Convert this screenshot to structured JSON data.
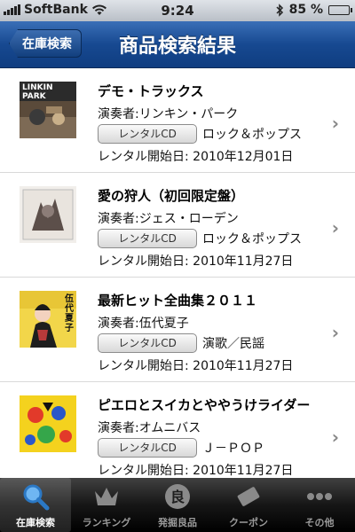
{
  "status": {
    "carrier": "SoftBank",
    "time": "9:24",
    "battery": "85 %",
    "battery_level": 0.85
  },
  "navbar": {
    "back_label": "在庫検索",
    "title": "商品検索結果"
  },
  "results": [
    {
      "title": "デモ・トラックス",
      "artist": "演奏者:リンキン・パーク",
      "format": "レンタルCD",
      "genre": "ロック＆ポップス",
      "rental_start": "レンタル開始日: 2010年12月01日",
      "cover_text": "LINKIN PARK"
    },
    {
      "title": "愛の狩人（初回限定盤）",
      "artist": "演奏者:ジェス・ローデン",
      "format": "レンタルCD",
      "genre": "ロック＆ポップス",
      "rental_start": "レンタル開始日: 2010年11月27日",
      "cover_text": ""
    },
    {
      "title": "最新ヒット全曲集２０１１",
      "artist": "演奏者:伍代夏子",
      "format": "レンタルCD",
      "genre": "演歌／民謡",
      "rental_start": "レンタル開始日: 2010年11月27日",
      "cover_text": "伍代夏子"
    },
    {
      "title": "ピエロとスイカとややうけライダー",
      "artist": "演奏者:オムニバス",
      "format": "レンタルCD",
      "genre": "Ｊ－ＰＯＰ",
      "rental_start": "レンタル開始日: 2010年11月27日",
      "cover_text": ""
    }
  ],
  "tabs": [
    {
      "label": "在庫検索",
      "icon": "search-icon"
    },
    {
      "label": "ランキング",
      "icon": "crown-icon"
    },
    {
      "label": "発掘良品",
      "icon": "ryo-seal-icon"
    },
    {
      "label": "クーポン",
      "icon": "coupon-icon"
    },
    {
      "label": "その他",
      "icon": "more-icon"
    }
  ]
}
